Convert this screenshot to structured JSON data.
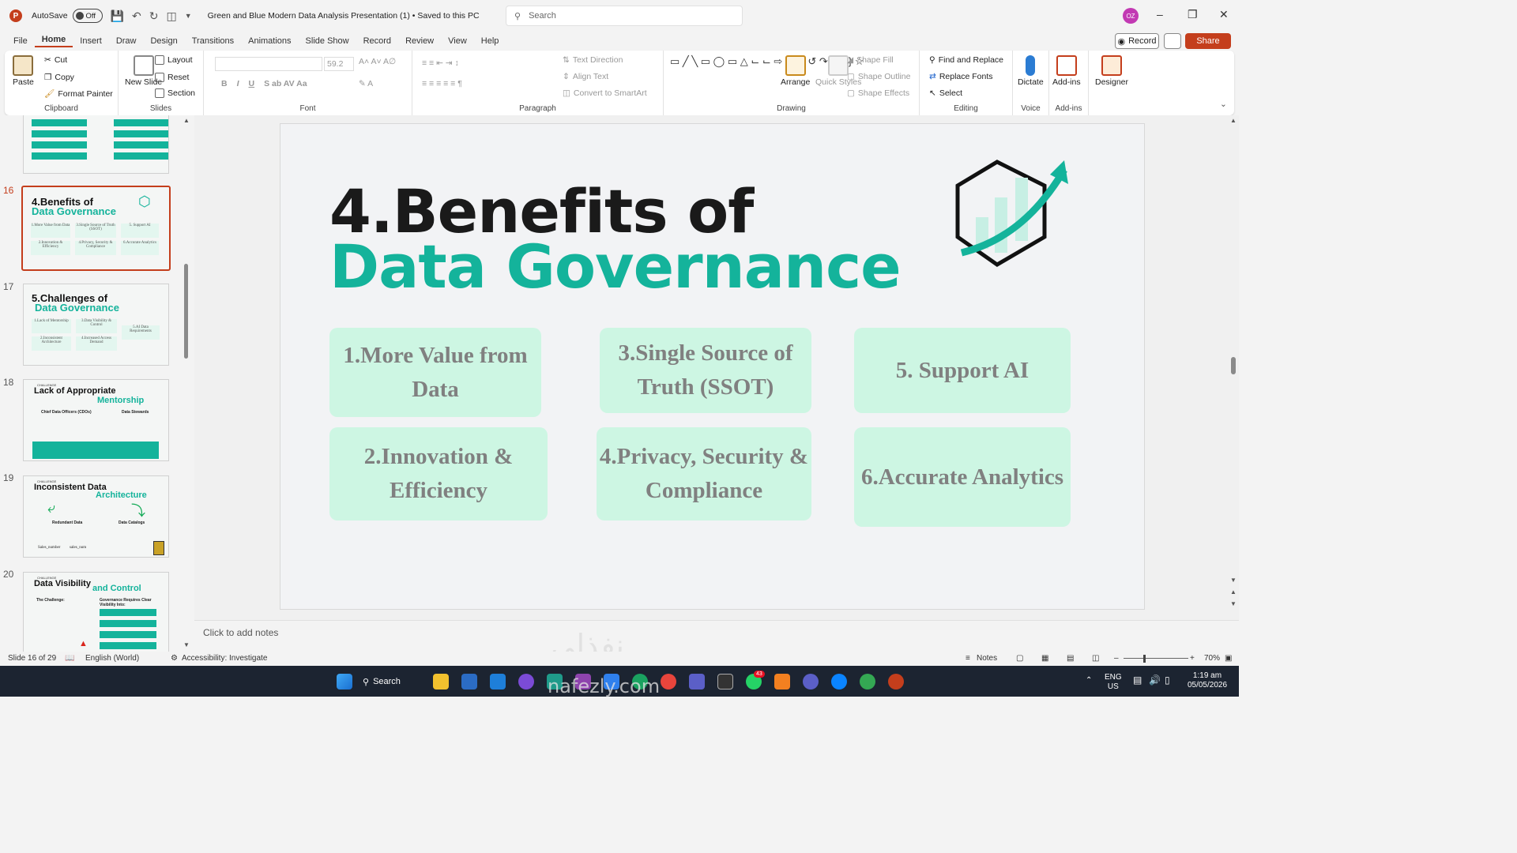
{
  "titlebar": {
    "autosave_label": "AutoSave",
    "autosave_state": "Off",
    "doc_title": "Green and Blue Modern Data Analysis Presentation (1)  •  Saved to this PC",
    "search_placeholder": "Search",
    "avatar_initials": "OZ"
  },
  "tabs": [
    "File",
    "Home",
    "Insert",
    "Draw",
    "Design",
    "Transitions",
    "Animations",
    "Slide Show",
    "Record",
    "Review",
    "View",
    "Help"
  ],
  "active_tab": "Home",
  "actions": {
    "record": "Record",
    "share": "Share"
  },
  "ribbon": {
    "clipboard": {
      "label": "Clipboard",
      "paste": "Paste",
      "cut": "Cut",
      "copy": "Copy",
      "format_painter": "Format Painter"
    },
    "slides": {
      "label": "Slides",
      "new_slide": "New Slide",
      "layout": "Layout",
      "reset": "Reset",
      "section": "Section"
    },
    "font": {
      "label": "Font",
      "font_size": "59.2"
    },
    "paragraph": {
      "label": "Paragraph",
      "text_direction": "Text Direction",
      "align_text": "Align Text",
      "convert_smartart": "Convert to SmartArt"
    },
    "drawing": {
      "label": "Drawing",
      "arrange": "Arrange",
      "quick_styles": "Quick Styles",
      "shape_fill": "Shape Fill",
      "shape_outline": "Shape Outline",
      "shape_effects": "Shape Effects"
    },
    "editing": {
      "label": "Editing",
      "find_replace": "Find and Replace",
      "replace_fonts": "Replace Fonts",
      "select": "Select"
    },
    "voice": {
      "label": "Voice",
      "dictate": "Dictate"
    },
    "addins": {
      "label": "Add-ins",
      "addins": "Add-ins"
    },
    "designer": "Designer"
  },
  "thumbnails": [
    {
      "num": "16",
      "title1": "4.Benefits of",
      "title2": "Data Governance",
      "boxes": [
        "1.More Value from Data",
        "3.Single Source of Truth (SSOT)",
        "5. Support AI",
        "2.Innovation & Efficiency",
        "4.Privacy, Security & Compliance",
        "6.Accurate Analytics"
      ]
    },
    {
      "num": "17",
      "title1": "5.Challenges of",
      "title2": "Data Governance",
      "boxes": [
        "1.Lack of Mentorship",
        "3.Data Visibility & Control",
        "5.AI Data Requirements",
        "2.Inconsistent Architecture",
        "4.Increased Access Demand"
      ]
    },
    {
      "num": "18",
      "title1": "Lack of Appropriate",
      "title2": "Mentorship",
      "tag": "CHALLENGE",
      "sub": [
        "Chief Data Officers (CDOs)",
        "Data Stewards"
      ]
    },
    {
      "num": "19",
      "title1": "Inconsistent Data",
      "title2": "Architecture",
      "tag": "CHALLENGE",
      "sub": [
        "Redundant Data",
        "Data Catalogs",
        "Sales_number",
        "sales_num"
      ]
    },
    {
      "num": "20",
      "title1": "Data Visibility",
      "title2": "and Control",
      "tag": "CHALLENGE",
      "sub": [
        "The Challenge:",
        "Governance Requires Clear Visibility Into:"
      ]
    }
  ],
  "slide": {
    "title_line1": "4.Benefits of",
    "title_line2": "Data Governance",
    "boxes": [
      {
        "line1": "1.More Value from",
        "line2": "Data"
      },
      {
        "line1": "3.Single Source of",
        "line2": "Truth (SSOT)"
      },
      {
        "line1": "5. Support AI",
        "line2": ""
      },
      {
        "line1": "2.Innovation &",
        "line2": "Efficiency"
      },
      {
        "line1": "4.Privacy, Security &",
        "line2": "Compliance"
      },
      {
        "line1": "6.Accurate Analytics",
        "line2": ""
      }
    ],
    "accent_color": "#14b39b",
    "box_color": "#cdf6e3"
  },
  "notes_placeholder": "Click to add notes",
  "status": {
    "slide_of": "Slide 16 of 29",
    "language": "English (World)",
    "accessibility": "Accessibility: Investigate",
    "notes": "Notes",
    "zoom": "70%"
  },
  "taskbar": {
    "search": "Search",
    "lang1": "ENG",
    "lang2": "US",
    "time": "1:19 am",
    "date": "05/05/2026",
    "badge_count": "43"
  },
  "watermark": "nafezly.com",
  "watermark_ar": "نفذلي"
}
